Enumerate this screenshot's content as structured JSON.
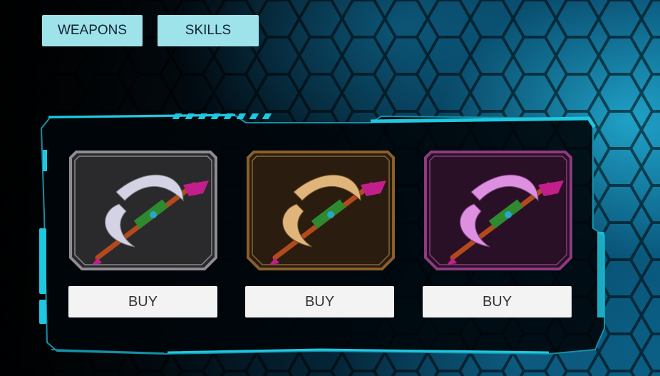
{
  "tabs": {
    "weapons_label": "WEAPONS",
    "skills_label": "SKILLS"
  },
  "shop": {
    "items": [
      {
        "buy_label": "BUY",
        "tier_color": "#c9c9cf",
        "frame_color": "#8e8e92",
        "panel_color": "#2a2a2c",
        "blade_color": "#d4d3e6"
      },
      {
        "buy_label": "BUY",
        "tier_color": "#c89a5c",
        "frame_color": "#8a5f2c",
        "panel_color": "#2a1c0e",
        "blade_color": "#e0b57c"
      },
      {
        "buy_label": "BUY",
        "tier_color": "#c25fb3",
        "frame_color": "#8e3a80",
        "panel_color": "#2a1026",
        "blade_color": "#dd8fe0"
      }
    ]
  },
  "icons": [
    "axe-weapon-icon"
  ],
  "colors": {
    "tab_bg": "#9fe3ea",
    "frame_cyan": "#1ec8e0",
    "button_bg": "#f3f3f3"
  }
}
